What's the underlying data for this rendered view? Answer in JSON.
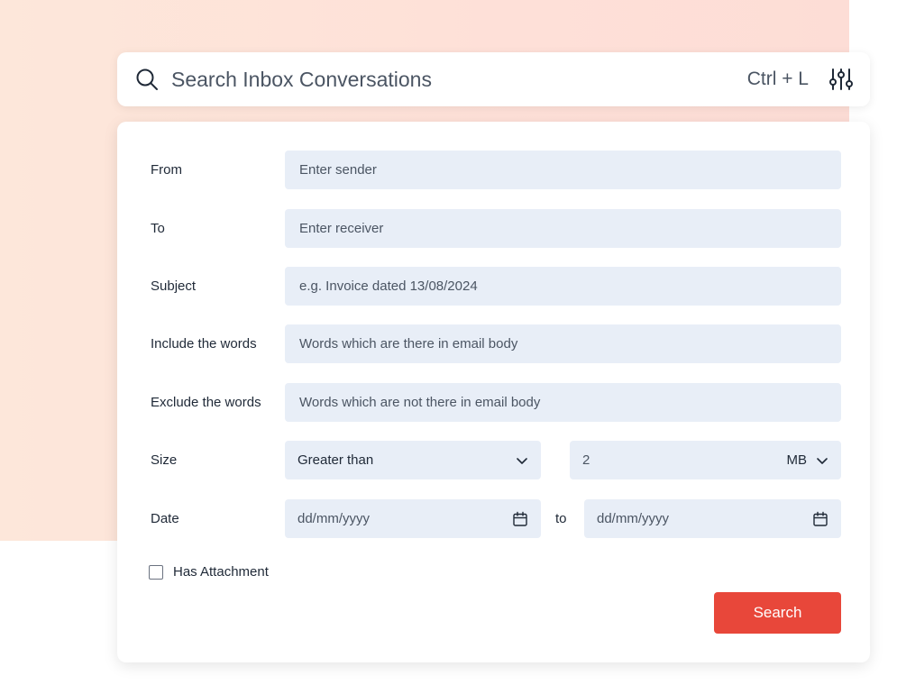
{
  "search": {
    "placeholder": "Search Inbox Conversations",
    "shortcut": "Ctrl + L",
    "icon": "search-icon",
    "filter_icon": "sliders-icon"
  },
  "form": {
    "from": {
      "label": "From",
      "placeholder": "Enter sender"
    },
    "to": {
      "label": "To",
      "placeholder": "Enter receiver"
    },
    "subject": {
      "label": "Subject",
      "placeholder": "e.g. Invoice dated 13/08/2024"
    },
    "include": {
      "label": "Include the words",
      "placeholder": "Words which are there in email body"
    },
    "exclude": {
      "label": "Exclude the words",
      "placeholder": "Words which are not there in email body"
    },
    "size": {
      "label": "Size",
      "comparator": "Greater than",
      "value": "2",
      "unit": "MB"
    },
    "date": {
      "label": "Date",
      "from_placeholder": "dd/mm/yyyy",
      "separator": "to",
      "to_placeholder": "dd/mm/yyyy"
    },
    "attachment": {
      "label": "Has Attachment",
      "checked": false
    },
    "submit_label": "Search"
  },
  "colors": {
    "accent": "#e8473a",
    "field_bg": "#e8eef7",
    "background_gradient": "#fde7da"
  }
}
